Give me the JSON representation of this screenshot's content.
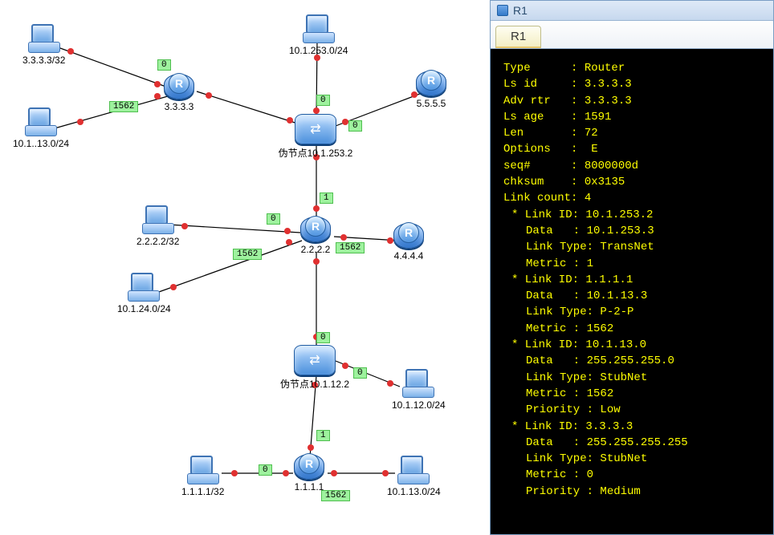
{
  "panel": {
    "title": "R1",
    "tab": "R1"
  },
  "term": {
    "type_l": "Type",
    "type_v": "Router",
    "lsid_l": "Ls id",
    "lsid_v": "3.3.3.3",
    "adv_l": "Adv rtr",
    "adv_v": "3.3.3.3",
    "age_l": "Ls age",
    "age_v": "1591",
    "len_l": "Len",
    "len_v": "72",
    "opt_l": "Options",
    "opt_v": "E",
    "seq_l": "seq#",
    "seq_v": "8000000d",
    "chk_l": "chksum",
    "chk_v": "0x3135",
    "lc_l": "Link count",
    "lc_v": "4",
    "l1": {
      "id": "10.1.253.2",
      "data": "10.1.253.3",
      "type": "TransNet",
      "metric": "1"
    },
    "l2": {
      "id": "1.1.1.1",
      "data": "10.1.13.3",
      "type": "P-2-P",
      "metric": "1562"
    },
    "l3": {
      "id": "10.1.13.0",
      "data": "255.255.255.0",
      "type": "StubNet",
      "metric": "1562",
      "prio": "Low"
    },
    "l4": {
      "id": "3.3.3.3",
      "data": "255.255.255.255",
      "type": "StubNet",
      "metric": "0",
      "prio": "Medium"
    }
  },
  "nodes": {
    "pc_333_32": "3.3.3.3/32",
    "pc_10_1_13": "10.1..13.0/24",
    "r_333": "3.3.3.3",
    "pc_10_1_253": "10.1.253.0/24",
    "sw_253": "伪节点10.1.253.2",
    "r_555": "5.5.5.5",
    "pc_222_32": "2.2.2.2/32",
    "pc_10_1_24": "10.1.24.0/24",
    "r_222": "2.2.2.2",
    "r_444": "4.4.4.4",
    "sw_12": "伪节点10.1.12.2",
    "pc_10_1_12": "10.1.12.0/24",
    "r_111": "1.1.1.1",
    "pc_111_32": "1.1.1.1/32",
    "pc_10_1_13b": "10.1.13.0/24"
  },
  "metrics": {
    "m0a": "0",
    "m1562a": "1562",
    "m0b": "0",
    "m0c": "0",
    "m1": "1",
    "m0d": "0",
    "m1562b": "1562",
    "m1562c": "1562",
    "m0e": "0",
    "m0f": "0",
    "m1b": "1",
    "m0g": "0",
    "m1562d": "1562"
  }
}
